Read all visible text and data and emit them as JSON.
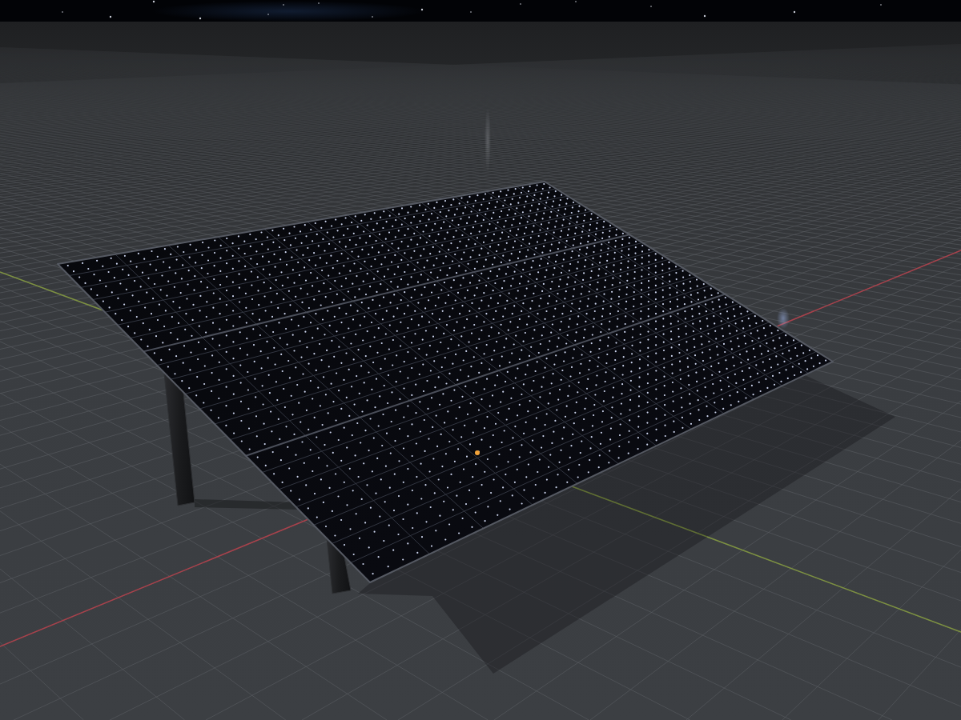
{
  "viewport": {
    "solar_panel": {
      "selected": true
    }
  }
}
